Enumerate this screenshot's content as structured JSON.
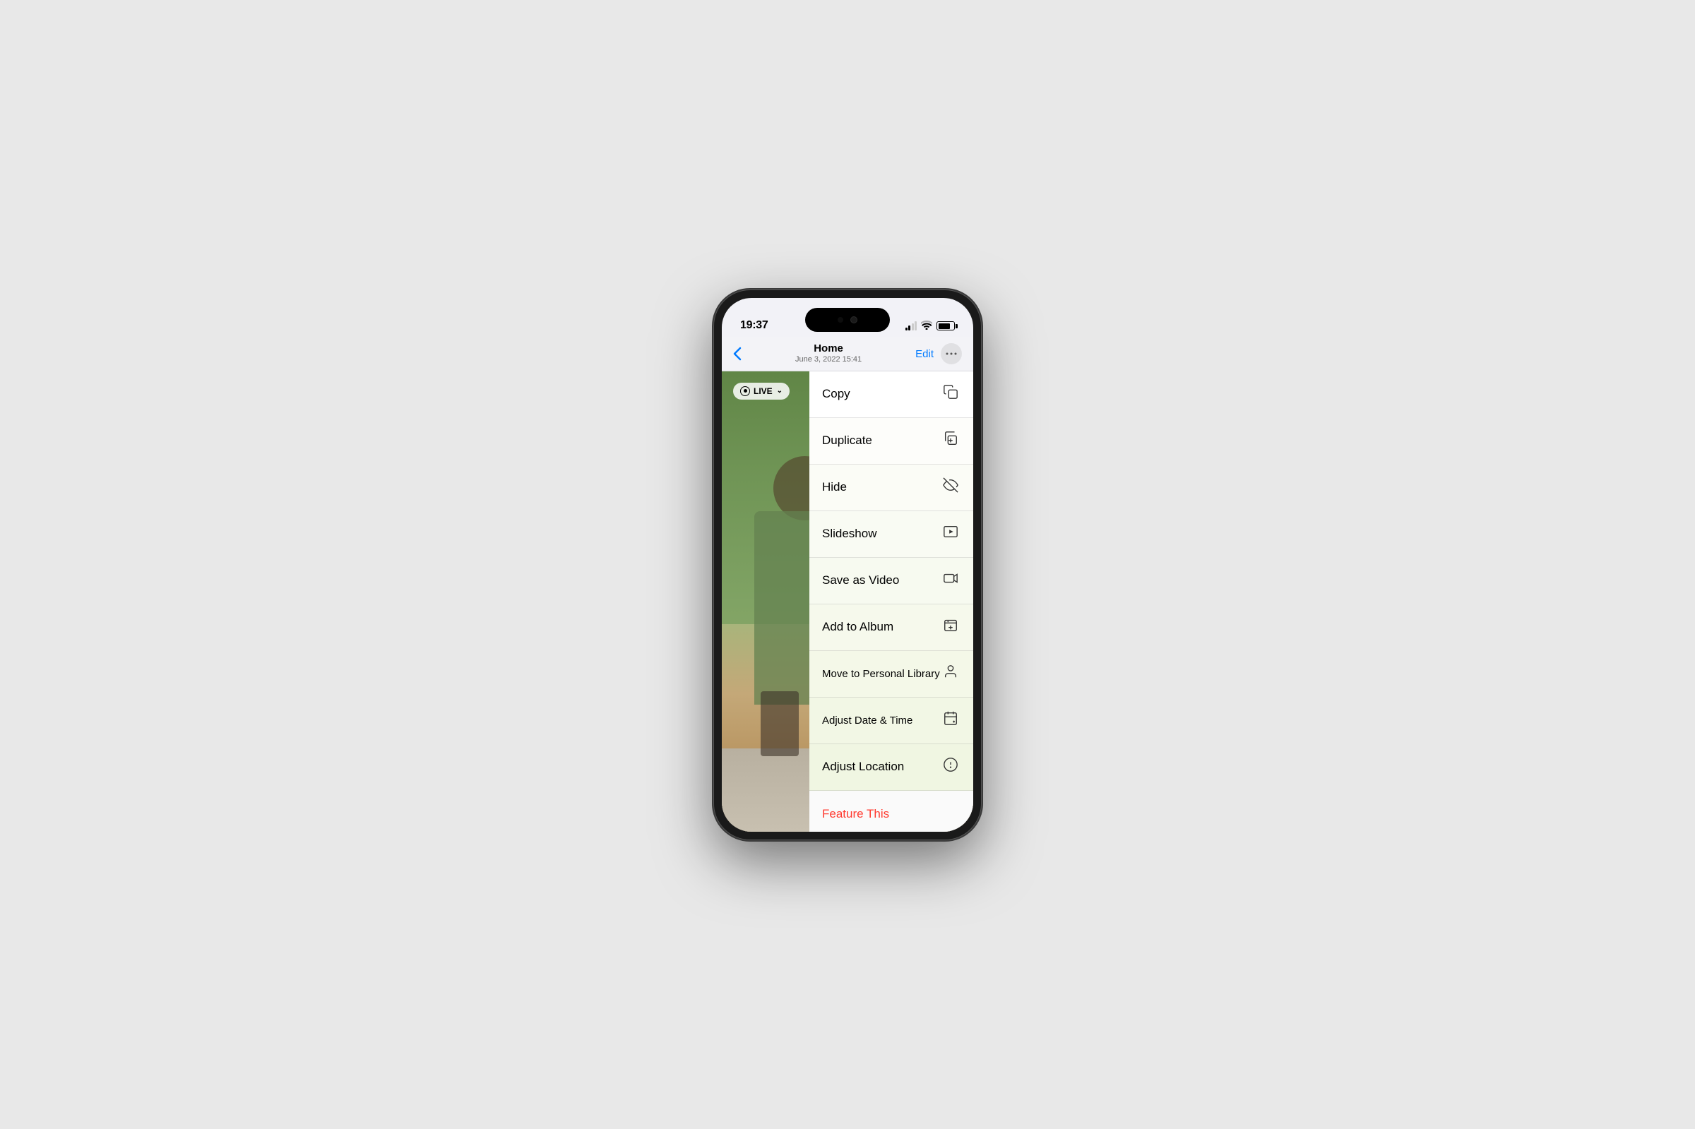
{
  "phone": {
    "status_bar": {
      "time": "19:37",
      "signal_label": "signal",
      "wifi_label": "wifi",
      "battery_label": "battery"
    },
    "nav": {
      "back_label": "‹",
      "title": "Home",
      "subtitle": "June 3, 2022  15:41",
      "edit_label": "Edit",
      "more_label": "···"
    },
    "photo": {
      "live_badge": "LIVE",
      "live_chevron": "⌄"
    },
    "context_menu": {
      "items": [
        {
          "id": "copy",
          "label": "Copy",
          "icon": "⎘"
        },
        {
          "id": "duplicate",
          "label": "Duplicate",
          "icon": "⊞"
        },
        {
          "id": "hide",
          "label": "Hide",
          "icon": "⊘"
        },
        {
          "id": "slideshow",
          "label": "Slideshow",
          "icon": "▶"
        },
        {
          "id": "save-as-video",
          "label": "Save as Video",
          "icon": "⏺"
        },
        {
          "id": "add-to-album",
          "label": "Add to Album",
          "icon": "⊕"
        },
        {
          "id": "move-to-personal-library",
          "label": "Move to Personal Library",
          "icon": "👤"
        },
        {
          "id": "adjust-date-time",
          "label": "Adjust Date & Time",
          "icon": "📅"
        },
        {
          "id": "adjust-location",
          "label": "Adjust Location",
          "icon": "ℹ"
        },
        {
          "id": "feature-this",
          "label": "Feature This",
          "icon": ""
        }
      ]
    }
  }
}
